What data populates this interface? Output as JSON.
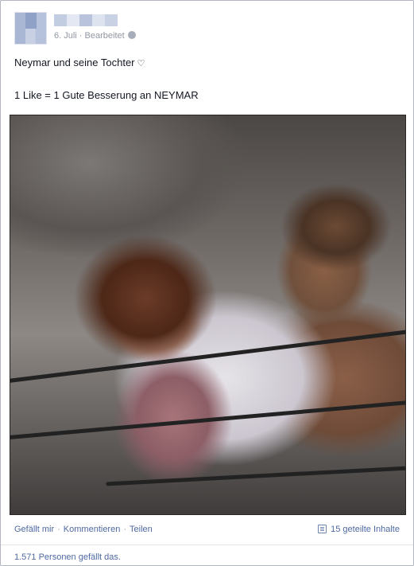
{
  "post": {
    "meta_date": "6. Juli",
    "meta_sep": " · ",
    "meta_edited": "Bearbeitet",
    "text_line1": "Neymar und seine Tochter",
    "heart": "♡",
    "text_line2": "1 Like = 1 Gute Besserung an NEYMAR"
  },
  "actions": {
    "like": "Gefällt mir",
    "comment": "Kommentieren",
    "share": "Teilen",
    "separator": "·",
    "shares_count": "15 geteilte Inhalte"
  },
  "likes_summary": "1.571 Personen gefällt das.",
  "icons": {
    "privacy": "globe-icon",
    "shares": "shares-icon"
  },
  "colors": {
    "link": "#4e69a2",
    "meta": "#9197a3",
    "text": "#141823"
  }
}
